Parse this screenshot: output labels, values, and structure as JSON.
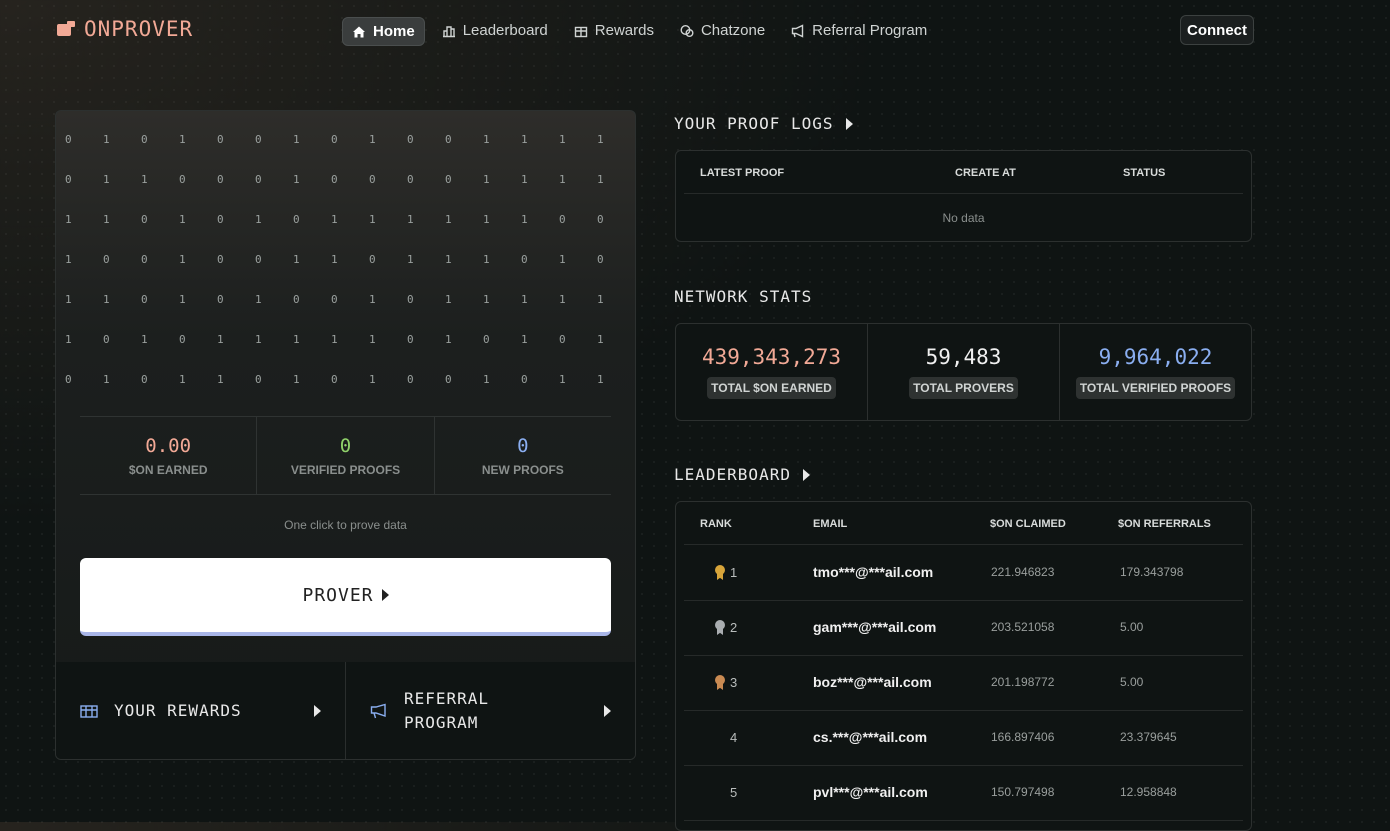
{
  "brand": {
    "name": "ONPROVER",
    "color": "#f2a996"
  },
  "nav": {
    "items": [
      {
        "label": "Home",
        "icon": "home-icon",
        "active": true
      },
      {
        "label": "Leaderboard",
        "icon": "leaderboard-icon",
        "active": false
      },
      {
        "label": "Rewards",
        "icon": "rewards-icon",
        "active": false
      },
      {
        "label": "Chatzone",
        "icon": "chat-icon",
        "active": false
      },
      {
        "label": "Referral Program",
        "icon": "megaphone-icon",
        "active": false
      }
    ],
    "connect_label": "Connect"
  },
  "prover_panel": {
    "binary_rows": [
      "010100101001111",
      "011000100001111",
      "110101011111100",
      "100100110111010",
      "110101001011111",
      "101011111010101",
      "010110101001011"
    ],
    "stats": [
      {
        "value": "0.00",
        "label": "$ON EARNED",
        "color": "#f2a996"
      },
      {
        "value": "0",
        "label": "VERIFIED PROOFS",
        "color": "#8fd16a"
      },
      {
        "value": "0",
        "label": "NEW PROOFS",
        "color": "#8aaef0"
      }
    ],
    "hint": "One click to prove data",
    "prover_label": "PROVER",
    "links": [
      {
        "label_line1": "YOUR REWARDS",
        "label_line2": "",
        "icon": "gift-icon"
      },
      {
        "label_line1": "REFERRAL",
        "label_line2": "PROGRAM",
        "icon": "megaphone-icon"
      }
    ]
  },
  "proof_logs": {
    "title": "YOUR PROOF LOGS",
    "columns": [
      "LATEST PROOF",
      "CREATE AT",
      "STATUS"
    ],
    "empty_text": "No data"
  },
  "network_stats": {
    "title": "NETWORK STATS",
    "items": [
      {
        "value": "439,343,273",
        "label": "TOTAL $ON EARNED",
        "color": "#f2a996"
      },
      {
        "value": "59,483",
        "label": "TOTAL PROVERS",
        "color": "#f0f0f0"
      },
      {
        "value": "9,964,022",
        "label": "TOTAL VERIFIED PROOFS",
        "color": "#8aaef0"
      }
    ]
  },
  "leaderboard": {
    "title": "LEADERBOARD",
    "columns": [
      "RANK",
      "EMAIL",
      "$ON CLAIMED",
      "$ON REFERRALS"
    ],
    "rows": [
      {
        "rank": "1",
        "email": "tmo***@***ail.com",
        "claimed": "221.946823",
        "referrals": "179.343798",
        "medal": "#d8a53a"
      },
      {
        "rank": "2",
        "email": "gam***@***ail.com",
        "claimed": "203.521058",
        "referrals": "5.00",
        "medal": "#a9adb0"
      },
      {
        "rank": "3",
        "email": "boz***@***ail.com",
        "claimed": "201.198772",
        "referrals": "5.00",
        "medal": "#c98a52"
      },
      {
        "rank": "4",
        "email": "cs.***@***ail.com",
        "claimed": "166.897406",
        "referrals": "23.379645",
        "medal": ""
      },
      {
        "rank": "5",
        "email": "pvl***@***ail.com",
        "claimed": "150.797498",
        "referrals": "12.958848",
        "medal": ""
      }
    ]
  }
}
